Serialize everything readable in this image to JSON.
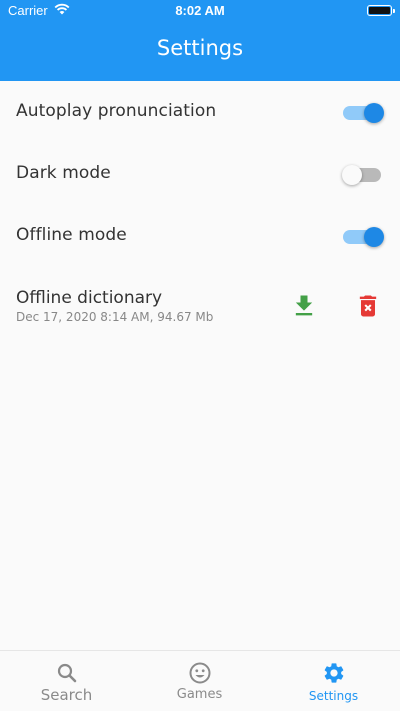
{
  "status_bar": {
    "carrier": "Carrier",
    "time": "8:02 AM"
  },
  "header": {
    "title": "Settings"
  },
  "settings": [
    {
      "label": "Autoplay pronunciation",
      "enabled": true
    },
    {
      "label": "Dark mode",
      "enabled": false
    },
    {
      "label": "Offline mode",
      "enabled": true
    }
  ],
  "offline_dictionary": {
    "title": "Offline dictionary",
    "meta": "Dec 17, 2020 8:14 AM, 94.67 Mb",
    "download_icon": "download-icon",
    "delete_icon": "delete-icon"
  },
  "bottom_nav": [
    {
      "label": "Search",
      "icon": "search-icon",
      "active": false
    },
    {
      "label": "Games",
      "icon": "smiley-icon",
      "active": false
    },
    {
      "label": "Settings",
      "icon": "gear-icon",
      "active": true
    }
  ],
  "colors": {
    "primary": "#2196f3",
    "toggle_on_thumb": "#1e88e5",
    "toggle_on_track": "#90caf9",
    "download": "#43a047",
    "delete": "#e53935"
  }
}
